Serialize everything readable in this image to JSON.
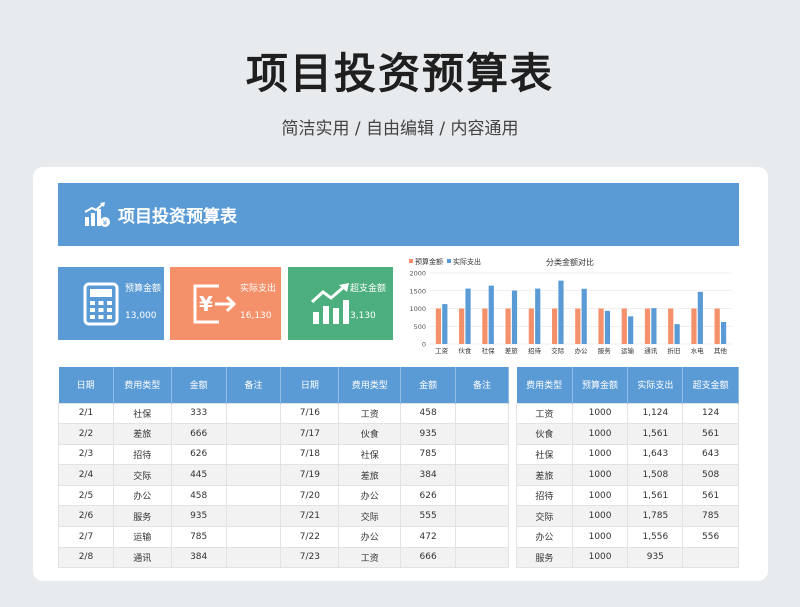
{
  "page": {
    "title": "项目投资预算表",
    "subtitle": "简洁实用 / 自由编辑 / 内容通用"
  },
  "banner": {
    "title": "项目投资预算表"
  },
  "kpis": [
    {
      "label": "预算金额",
      "value": "13,000",
      "color": "#5b9bd5",
      "icon": "calculator-icon"
    },
    {
      "label": "实际支出",
      "value": "16,130",
      "color": "#f4906a",
      "icon": "yen-transfer-icon"
    },
    {
      "label": "超支金额",
      "value": "3,130",
      "color": "#4caf7d",
      "icon": "rising-chart-icon"
    }
  ],
  "chart_data": {
    "type": "bar",
    "title": "分类金额对比",
    "categories": [
      "工资",
      "伙食",
      "社保",
      "差旅",
      "招待",
      "交际",
      "办公",
      "服务",
      "运输",
      "通讯",
      "折旧",
      "水电",
      "其他"
    ],
    "series": [
      {
        "name": "预算金额",
        "color": "#f4906a",
        "values": [
          1000,
          1000,
          1000,
          1000,
          1000,
          1000,
          1000,
          1000,
          1000,
          1000,
          1000,
          1000,
          1000
        ]
      },
      {
        "name": "实际支出",
        "color": "#5b9bd5",
        "values": [
          1124,
          1561,
          1643,
          1508,
          1561,
          1785,
          1556,
          935,
          780,
          1010,
          560,
          1470,
          620
        ]
      }
    ],
    "ylim": [
      0,
      2000
    ],
    "yticks": [
      0,
      500,
      1000,
      1500,
      2000
    ],
    "legend": "top-left",
    "grid": true
  },
  "detail_table": {
    "headers": [
      "日期",
      "费用类型",
      "金额",
      "备注",
      "日期",
      "费用类型",
      "金额",
      "备注"
    ],
    "rows": [
      [
        "2/1",
        "社保",
        "333",
        "",
        "7/16",
        "工资",
        "458",
        ""
      ],
      [
        "2/2",
        "差旅",
        "666",
        "",
        "7/17",
        "伙食",
        "935",
        ""
      ],
      [
        "2/3",
        "招待",
        "626",
        "",
        "7/18",
        "社保",
        "785",
        ""
      ],
      [
        "2/4",
        "交际",
        "445",
        "",
        "7/19",
        "差旅",
        "384",
        ""
      ],
      [
        "2/5",
        "办公",
        "458",
        "",
        "7/20",
        "办公",
        "626",
        ""
      ],
      [
        "2/6",
        "服务",
        "935",
        "",
        "7/21",
        "交际",
        "555",
        ""
      ],
      [
        "2/7",
        "运输",
        "785",
        "",
        "7/22",
        "办公",
        "472",
        ""
      ],
      [
        "2/8",
        "通讯",
        "384",
        "",
        "7/23",
        "工资",
        "666",
        ""
      ]
    ]
  },
  "summary_table": {
    "headers": [
      "费用类型",
      "预算金额",
      "实际支出",
      "超支金额"
    ],
    "rows": [
      [
        "工资",
        "1000",
        "1,124",
        "124"
      ],
      [
        "伙食",
        "1000",
        "1,561",
        "561"
      ],
      [
        "社保",
        "1000",
        "1,643",
        "643"
      ],
      [
        "差旅",
        "1000",
        "1,508",
        "508"
      ],
      [
        "招待",
        "1000",
        "1,561",
        "561"
      ],
      [
        "交际",
        "1000",
        "1,785",
        "785"
      ],
      [
        "办公",
        "1000",
        "1,556",
        "556"
      ],
      [
        "服务",
        "1000",
        "935",
        ""
      ]
    ]
  }
}
